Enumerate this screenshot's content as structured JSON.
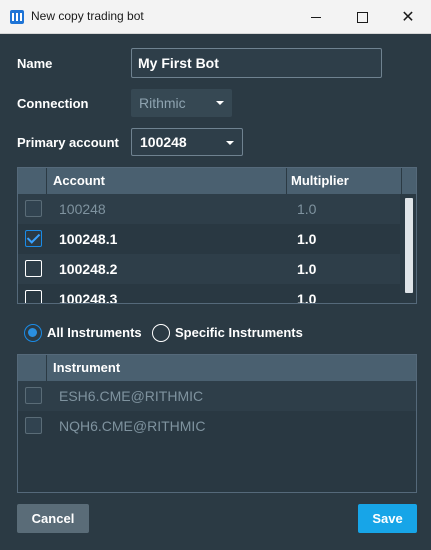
{
  "window": {
    "title": "New copy trading bot",
    "close_glyph": "✕"
  },
  "form": {
    "name_label": "Name",
    "name_value": "My First Bot",
    "connection_label": "Connection",
    "connection_value": "Rithmic",
    "primary_account_label": "Primary account",
    "primary_account_value": "100248"
  },
  "accounts_table": {
    "headers": {
      "account": "Account",
      "multiplier": "Multiplier"
    },
    "rows": [
      {
        "account": "100248",
        "multiplier": "1.0",
        "checked": false,
        "disabled": true
      },
      {
        "account": "100248.1",
        "multiplier": "1.0",
        "checked": true,
        "disabled": false
      },
      {
        "account": "100248.2",
        "multiplier": "1.0",
        "checked": false,
        "disabled": false
      },
      {
        "account": "100248.3",
        "multiplier": "1.0",
        "checked": false,
        "disabled": false
      }
    ]
  },
  "instrument_mode": {
    "all_label": "All Instruments",
    "specific_label": "Specific Instruments",
    "selected": "all"
  },
  "instruments_table": {
    "header": "Instrument",
    "rows": [
      {
        "instrument": "ESH6.CME@RITHMIC",
        "checked": false,
        "disabled": true
      },
      {
        "instrument": "NQH6.CME@RITHMIC",
        "checked": false,
        "disabled": true
      }
    ]
  },
  "buttons": {
    "cancel": "Cancel",
    "save": "Save"
  },
  "colors": {
    "background": "#2b3a44",
    "accent": "#17a5e8",
    "header": "#4a6070"
  },
  "icons": {
    "app": "app-logo-icon",
    "minimize": "minimize-icon",
    "maximize": "maximize-icon",
    "close": "close-icon",
    "dropdown": "chevron-down-icon",
    "check": "checkmark-icon"
  }
}
